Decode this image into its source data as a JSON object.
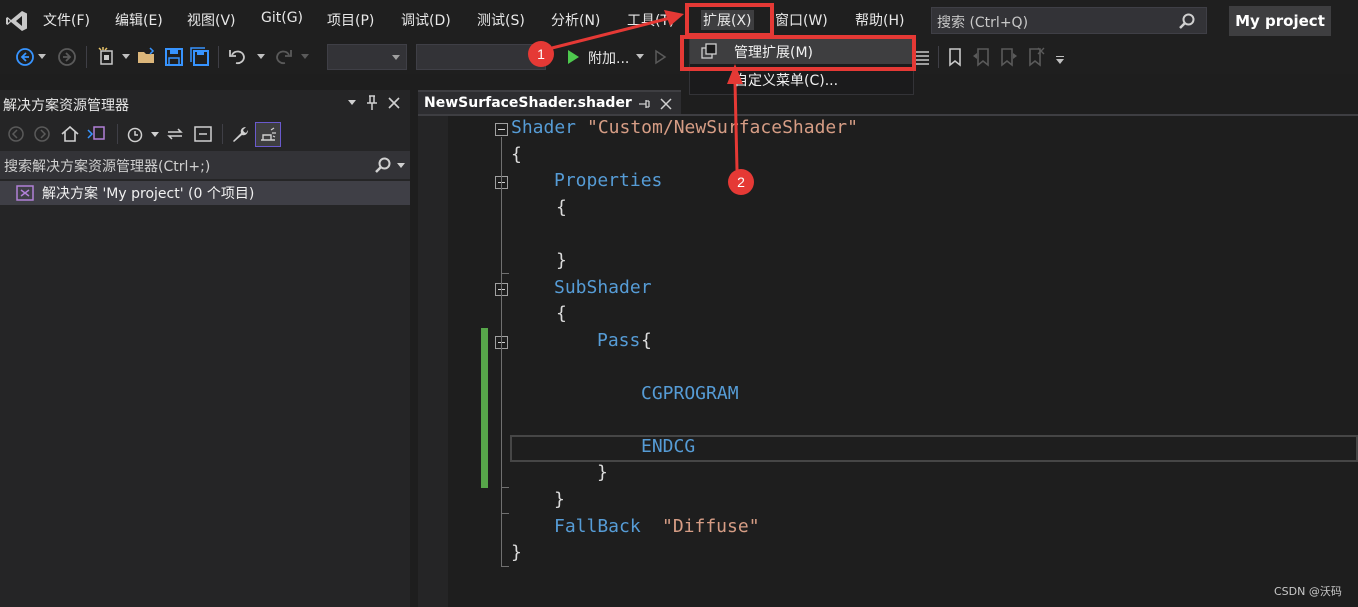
{
  "menubar": {
    "items": [
      "文件(F)",
      "编辑(E)",
      "视图(V)",
      "Git(G)",
      "项目(P)",
      "调试(D)",
      "测试(S)",
      "分析(N)",
      "工具(T)",
      "扩展(X)",
      "窗口(W)",
      "帮助(H)"
    ],
    "search_placeholder": "搜索 (Ctrl+Q)",
    "project_name": "My project"
  },
  "toolbar": {
    "attach_label": "附加..."
  },
  "extensions_menu": {
    "items": [
      "管理扩展(M)",
      "自定义菜单(C)..."
    ]
  },
  "solution_explorer": {
    "title": "解决方案资源管理器",
    "search_placeholder": "搜索解决方案资源管理器(Ctrl+;)",
    "root_item": "解决方案 'My project' (0 个项目)"
  },
  "editor": {
    "tab_title": "NewSurfaceShader.shader",
    "code": {
      "shader_kw": "Shader",
      "shader_name": "\"Custom/NewSurfaceShader\"",
      "open_brace": "{",
      "close_brace": "}",
      "properties": "Properties",
      "subshader": "SubShader",
      "pass": "Pass",
      "cgprogram": "CGPROGRAM",
      "endcg": "ENDCG",
      "fallback_kw": "FallBack",
      "fallback_name": "\"Diffuse\""
    }
  },
  "annotations": {
    "step1": "1",
    "step2": "2",
    "accent_color": "#e53935"
  },
  "watermark": "CSDN @沃码"
}
